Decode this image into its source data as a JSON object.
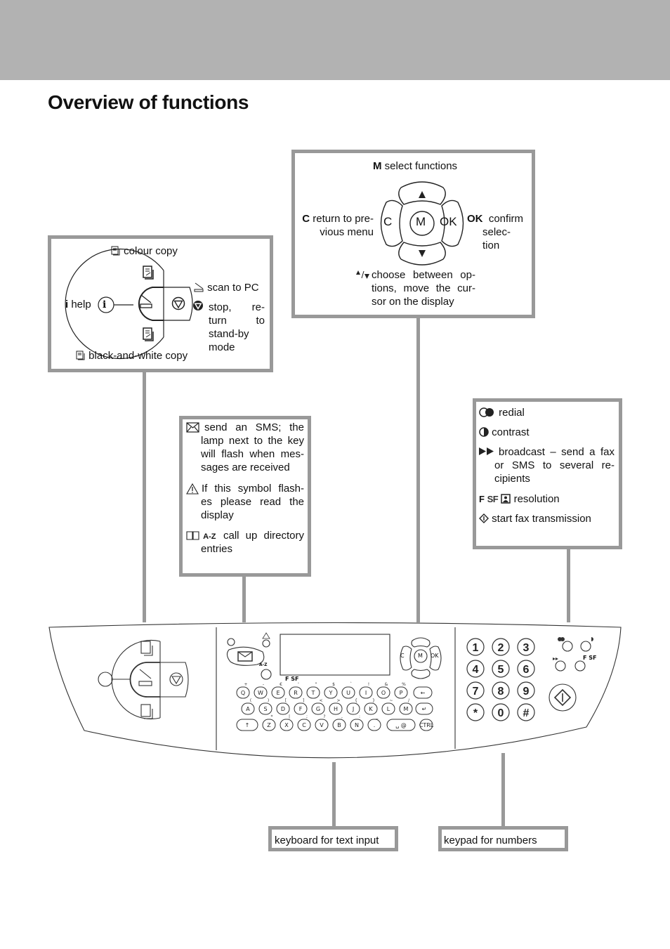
{
  "page": {
    "title": "Overview of functions"
  },
  "copy_box": {
    "colour_copy": "colour copy",
    "help_key": "i",
    "help": "help",
    "scan_to_pc": "scan to PC",
    "stop_lines": [
      "stop,  re-",
      "turn  to",
      "stand-by",
      "mode"
    ],
    "bw_copy": "black-and-white copy"
  },
  "nav_box": {
    "m_key": "M",
    "m_text": "select functions",
    "c_key": "C",
    "c_text_1": "return to pre-",
    "c_text_2": "vious menu",
    "ok_key": "OK",
    "ok_text_1": "confirm",
    "ok_text_2": "selec-",
    "ok_text_3": "tion",
    "arrows_text_1": "choose between op-",
    "arrows_text_2": "tions, move the cur-",
    "arrows_text_3": "sor on the display",
    "btn_c": "C",
    "btn_m": "M",
    "btn_ok": "OK"
  },
  "sms_box": {
    "sms_lines": [
      "send  an  SMS;  the",
      "lamp next to the key",
      "will flash when mes-",
      "sages are received"
    ],
    "warning_lines": [
      "If this symbol flash-",
      "es  please  read  the",
      "display"
    ],
    "directory_key": "A-Z",
    "directory_lines": [
      "call  up  directory",
      "entries"
    ]
  },
  "fax_box": {
    "redial": "redial",
    "contrast": "contrast",
    "broadcast_lines": [
      "broadcast – send a fax",
      "or  SMS  to  several  re-",
      "cipients"
    ],
    "resolution_icons": [
      "F",
      "SF"
    ],
    "resolution": "resolution",
    "start": "start fax transmission"
  },
  "bottom_labels": {
    "keyboard": "keyboard for text input",
    "keypad": "keypad for numbers"
  },
  "panel": {
    "keyboard_row1": [
      {
        "key": "Q",
        "alt": "+"
      },
      {
        "key": "W",
        "alt": "-"
      },
      {
        "key": "E",
        "alt": "€"
      },
      {
        "key": "R",
        "alt": "'"
      },
      {
        "key": "T",
        "alt": "\""
      },
      {
        "key": "Y",
        "alt": "$"
      },
      {
        "key": "U",
        "alt": "`"
      },
      {
        "key": "I",
        "alt": "!"
      },
      {
        "key": "O",
        "alt": "&"
      },
      {
        "key": "P",
        "alt": "%"
      }
    ],
    "keyboard_row2": [
      {
        "key": "A",
        "alt": "("
      },
      {
        "key": "S",
        "alt": ")"
      },
      {
        "key": "D",
        "alt": "["
      },
      {
        "key": "F",
        "alt": "]"
      },
      {
        "key": "G",
        "alt": "<"
      },
      {
        "key": "H",
        "alt": ">"
      },
      {
        "key": "J",
        "alt": "{"
      },
      {
        "key": "K",
        "alt": "}"
      },
      {
        "key": "L",
        "alt": "~"
      },
      {
        "key": "M",
        "alt": "/"
      }
    ],
    "keyboard_row3": [
      {
        "key": "Z",
        "alt": "*"
      },
      {
        "key": "X",
        "alt": "|"
      },
      {
        "key": "C",
        "alt": ";"
      },
      {
        "key": "V",
        "alt": "?"
      },
      {
        "key": "B",
        "alt": ","
      },
      {
        "key": "N",
        "alt": ":"
      },
      {
        "key": ".",
        "alt": "_"
      }
    ],
    "space_key": "␣ @",
    "ctrl_key": "CTRL",
    "shift_key": "↑",
    "backspace_key": "←",
    "enter_key": "↵",
    "directory_label": "A-Z",
    "res_label": "F  SF",
    "keypad": [
      "1",
      "2",
      "3",
      "4",
      "5",
      "6",
      "7",
      "8",
      "9",
      "*",
      "0",
      "#"
    ],
    "nav_c": "C",
    "nav_m": "M",
    "nav_ok": "OK"
  }
}
